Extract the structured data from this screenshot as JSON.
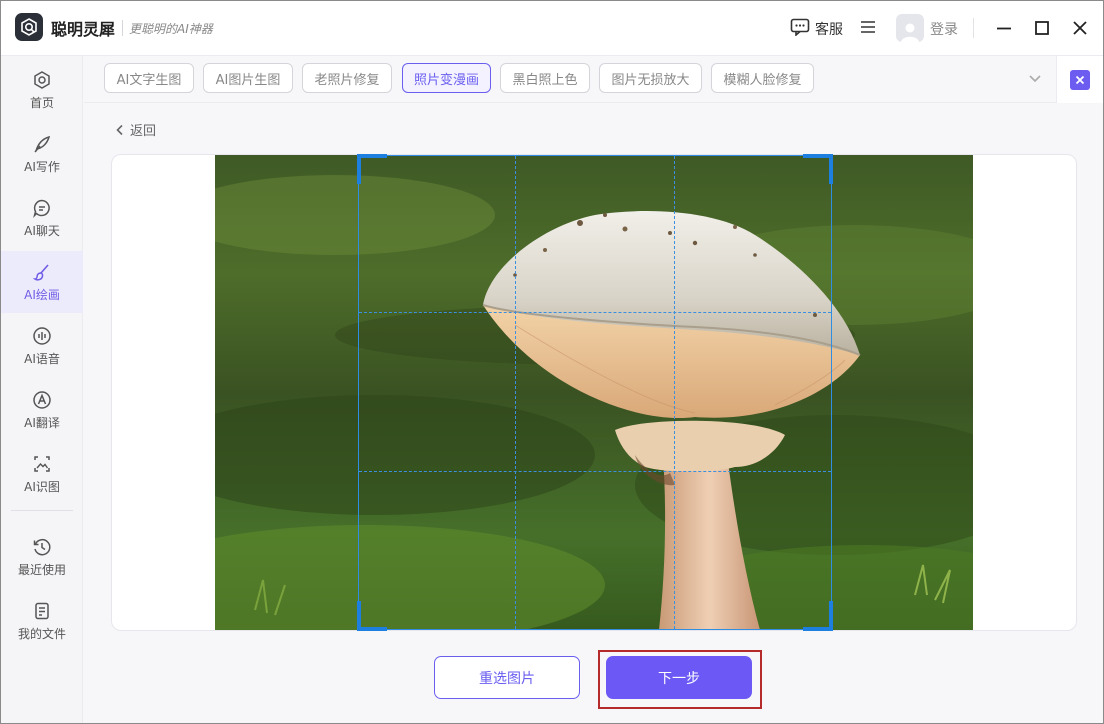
{
  "app": {
    "name": "聪明灵犀",
    "slogan": "更聪明的AI神器"
  },
  "header": {
    "service_label": "客服",
    "login_label": "登录"
  },
  "icons": {
    "logo": "brain-logo-icon",
    "service": "chat-bubble-icon",
    "menu": "hamburger-menu-icon",
    "avatar": "user-avatar-icon",
    "minimize": "minimize-icon",
    "maximize": "maximize-icon",
    "close": "close-icon"
  },
  "sidebar": {
    "items": [
      {
        "label": "首页",
        "icon": "home-icon",
        "active": false
      },
      {
        "label": "AI写作",
        "icon": "quill-icon",
        "active": false
      },
      {
        "label": "AI聊天",
        "icon": "chat-icon",
        "active": false
      },
      {
        "label": "AI绘画",
        "icon": "brush-icon",
        "active": true
      },
      {
        "label": "AI语音",
        "icon": "voice-icon",
        "active": false
      },
      {
        "label": "AI翻译",
        "icon": "translate-icon",
        "active": false
      },
      {
        "label": "AI识图",
        "icon": "image-recognize-icon",
        "active": false
      }
    ],
    "bottom_items": [
      {
        "label": "最近使用",
        "icon": "clock-icon"
      },
      {
        "label": "我的文件",
        "icon": "file-icon"
      }
    ]
  },
  "tools": {
    "tabs": [
      {
        "label": "AI文字生图",
        "active": false
      },
      {
        "label": "AI图片生图",
        "active": false
      },
      {
        "label": "老照片修复",
        "active": false
      },
      {
        "label": "照片变漫画",
        "active": true
      },
      {
        "label": "黑白照上色",
        "active": false
      },
      {
        "label": "图片无损放大",
        "active": false
      },
      {
        "label": "模糊人脸修复",
        "active": false
      }
    ]
  },
  "editor": {
    "back_label": "返回",
    "reselect_label": "重选图片",
    "next_label": "下一步"
  },
  "colors": {
    "accent": "#6c58f4",
    "crop_frame": "#1d7fe0",
    "highlight": "#b52a2a"
  }
}
